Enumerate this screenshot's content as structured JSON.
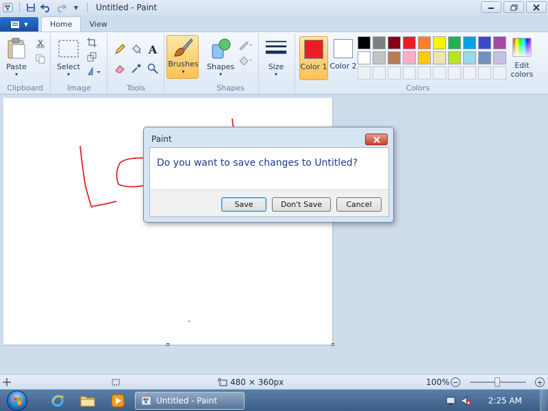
{
  "window": {
    "title": "Untitled - Paint",
    "minimize_glyph": "▭",
    "restore_glyph": "❐",
    "close_glyph": "✕"
  },
  "quick_access": {
    "save_icon": "save-icon",
    "undo_icon": "undo-icon",
    "redo_icon": "redo-icon",
    "customize_glyph": "▾"
  },
  "ribbon_tabs": {
    "app_menu_glyph": "▾",
    "home": "Home",
    "view": "View"
  },
  "ribbon": {
    "clipboard": {
      "label": "Clipboard",
      "paste": "Paste"
    },
    "image": {
      "label": "Image",
      "select": "Select"
    },
    "tools": {
      "label": "Tools"
    },
    "brushes": "Brushes",
    "shapes": {
      "label": "Shapes",
      "button": "Shapes"
    },
    "size": "Size",
    "colors": {
      "label": "Colors",
      "color1": "Color 1",
      "color1_num": "1",
      "color2": "Color 2",
      "color2_num": "2",
      "color1_value": "#ed1c24",
      "color2_value": "#ffffff",
      "edit_colors": "Edit colors",
      "palette": [
        "#000000",
        "#7f7f7f",
        "#880015",
        "#ed1c24",
        "#ff7f27",
        "#fff200",
        "#22b14c",
        "#00a2e8",
        "#3f48cc",
        "#a349a4",
        "#ffffff",
        "#c3c3c3",
        "#b97a57",
        "#ffaec9",
        "#ffc90e",
        "#efe4b0",
        "#b5e61d",
        "#99d9ea",
        "#7092be",
        "#c8bfe7",
        "",
        "",
        "",
        "",
        "",
        "",
        "",
        "",
        "",
        ""
      ]
    }
  },
  "dialog": {
    "title": "Paint",
    "message": "Do you want to save changes to Untitled?",
    "save": "Save",
    "dont_save": "Don't Save",
    "cancel": "Cancel"
  },
  "statusbar": {
    "dimensions": "480 × 360px",
    "zoom": "100%",
    "zoom_out": "−",
    "zoom_in": "+"
  },
  "taskbar": {
    "task_label": "Untitled - Paint",
    "clock": "2:25 AM"
  }
}
